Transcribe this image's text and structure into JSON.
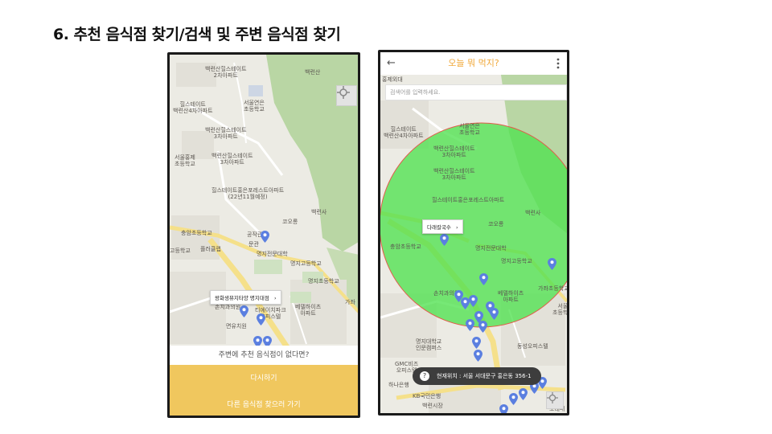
{
  "slide": {
    "title": "6. 추천 음식점 찾기/검색 및 주변 음식점 찾기"
  },
  "colors": {
    "accent_yellow": "#f0c75e",
    "title_orange": "#f0a93b",
    "radius_fill": "#4fe14f",
    "pin_blue": "#5b7fe0",
    "park_green": "#b9d6a4"
  },
  "left_screen": {
    "map_labels": {
      "a": "백련산힐스테이트\n2차아파트",
      "b": "백련산",
      "c": "힐스테이트\n백련산4차아파트",
      "d": "서울연은\n초등학교",
      "e": "백련산힐스테이트\n3차아파트",
      "f": "서울홍제\n초등학교",
      "g": "백련산힐스테이트\n3차아파트",
      "h": "힐스테이트홍은포레스트아파트\n(22년11월예정)",
      "i": "백련사",
      "j": "코오롱",
      "k": "충암초등학교",
      "l": "플러클랩",
      "m": "공작관",
      "n": "문관",
      "o": "명지전문대학",
      "p": "명지고등학교",
      "q": "명지초등학교",
      "r": "고등학교",
      "s": "손치과의원",
      "t": "티에이치파크\n오피스텔",
      "u": "면유치원",
      "v": "베델하이츠\n아파트",
      "w": "가좌"
    },
    "callout": "왕화생뮤지타양 명지대점",
    "question": "주변에 추천 음식점이 없다면?",
    "retry_button": "다시하기",
    "other_button": "다른 음식점 찾으러 가기",
    "icons": [
      "locate-icon",
      "map-pin-icon",
      "chevron-right-icon"
    ]
  },
  "right_screen": {
    "title": "오늘 뭐 먹지?",
    "search_placeholder": "검색어를 입력하세요.",
    "callout": "다래칼국수",
    "location_text": "현재위치 : 서울 서대문구 홍은동 356-1",
    "location_icon_glyph": "?",
    "back_glyph": "←",
    "map_labels": {
      "a": "홍제외대",
      "b": "힐스테이트\n백련산4차아파트",
      "c": "서울연은\n초등학교",
      "d": "백련산힐스테이트\n3차아파트",
      "e": "백련산힐스테이트\n3차아파트",
      "f": "힐스테이트홍은포레스트아파트",
      "g": "백련사",
      "h": "코오롱",
      "i": "충암초등학교",
      "j": "명지전문대학",
      "k": "명지고등학교",
      "l": "가좌초등학교",
      "m": "손치과의원",
      "n": "베델하이츠\n아파트",
      "o": "명지대학교\n인문캠퍼스",
      "p": "동성오피스텔",
      "q": "GMC비즈\n오피스텔",
      "r": "KB국민은행",
      "s": "하나은행",
      "t": "백련시장",
      "u": "모래내",
      "v": "서울\n초등학교"
    },
    "icons": [
      "back-arrow-icon",
      "more-vert-icon",
      "locate-icon",
      "map-pin-icon",
      "question-icon"
    ]
  }
}
